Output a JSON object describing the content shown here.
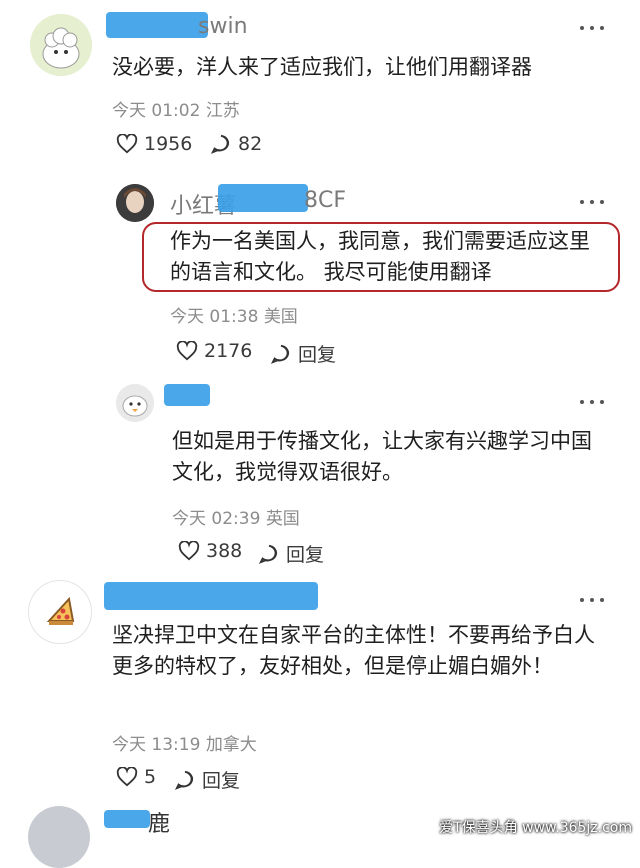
{
  "comments": [
    {
      "name_visible": "swin",
      "text": "没必要，洋人来了适应我们，让他们用翻译器",
      "time": "今天 01:02",
      "location": "江苏",
      "likes": "1956",
      "replies": "82"
    },
    {
      "name_visible_prefix": "小红薯",
      "name_visible_suffix": "8CF",
      "text": "作为一名美国人，我同意，我们需要适应这里的语言和文化。 我尽可能使用翻译",
      "time": "今天 01:38",
      "location": "美国",
      "likes": "2176",
      "reply_label": "回复"
    },
    {
      "text": "但如是用于传播文化，让大家有兴趣学习中国文化，我觉得双语很好。",
      "time": "今天 02:39",
      "location": "英国",
      "likes": "388",
      "reply_label": "回复"
    },
    {
      "text": "坚决捍卫中文在自家平台的主体性！不要再给予白人更多的特权了，友好相处，但是停止媚白媚外！",
      "time": "今天 13:19",
      "location": "加拿大",
      "likes": "5",
      "reply_label": "回复"
    },
    {
      "name_visible": "鹿"
    }
  ],
  "watermark": "爱T保喜头角 www.365jz.com",
  "colors": {
    "mask": "#3aa0e8",
    "highlight": "#b4272a"
  }
}
